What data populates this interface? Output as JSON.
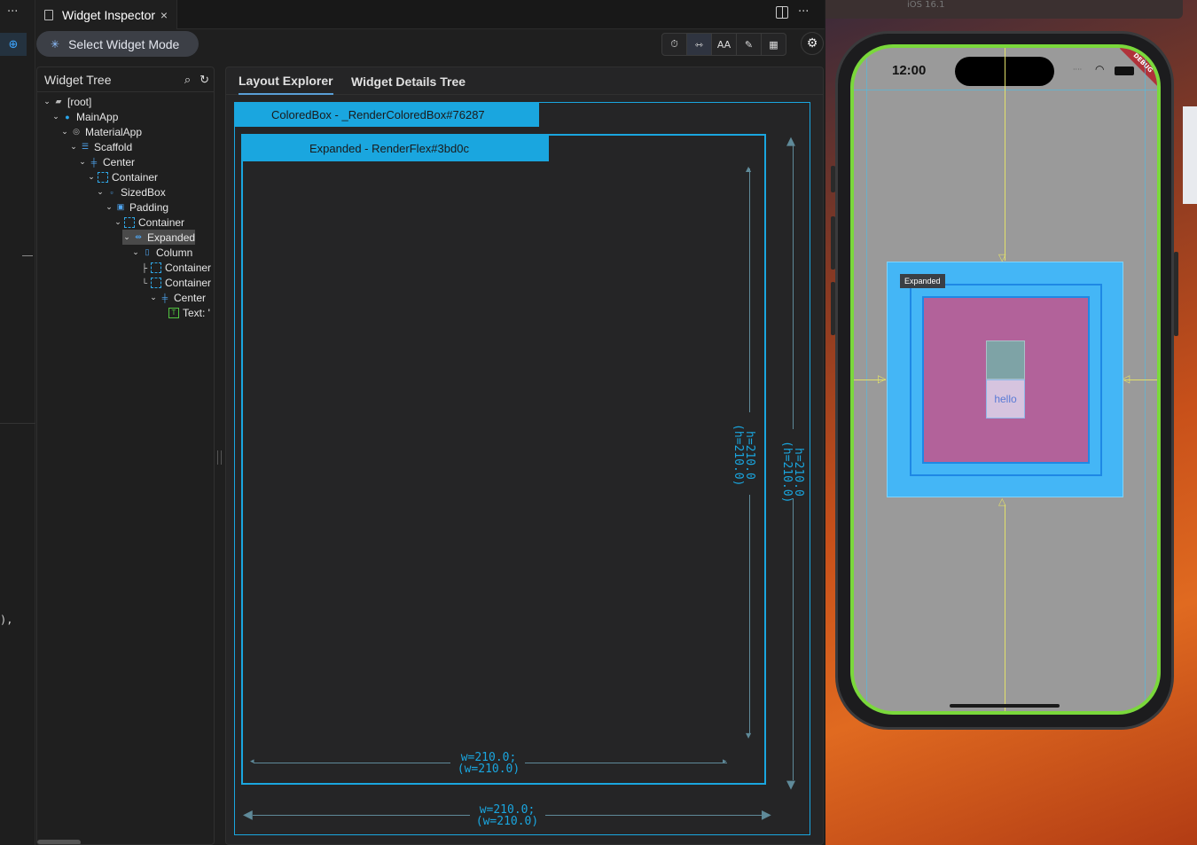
{
  "tab": {
    "title": "Widget Inspector",
    "close": "×"
  },
  "titlebar": {
    "menu": "···",
    "split": "▯",
    "more": "···"
  },
  "toolbar": {
    "select_mode": "Select Widget Mode",
    "tools": [
      "⏱",
      "⇿",
      "AA",
      "✎",
      "▦"
    ],
    "settings_icon": "⚙"
  },
  "tree": {
    "title": "Widget Tree",
    "nodes": [
      {
        "label": "[root]",
        "icon": "folder-icon"
      },
      {
        "label": "MainApp",
        "icon": "app-icon"
      },
      {
        "label": "MaterialApp",
        "icon": "material-icon"
      },
      {
        "label": "Scaffold",
        "icon": "scaffold-icon"
      },
      {
        "label": "Center",
        "icon": "center-icon"
      },
      {
        "label": "Container",
        "icon": "container-icon"
      },
      {
        "label": "SizedBox",
        "icon": "sizedbox-icon"
      },
      {
        "label": "Padding",
        "icon": "padding-icon"
      },
      {
        "label": "Container",
        "icon": "container-icon"
      },
      {
        "label": "Expanded",
        "icon": "expanded-icon"
      },
      {
        "label": "Column",
        "icon": "column-icon"
      },
      {
        "label": "Container",
        "icon": "container-icon"
      },
      {
        "label": "Container",
        "icon": "container-icon"
      },
      {
        "label": "Center",
        "icon": "center-icon"
      },
      {
        "label": "Text: '",
        "icon": "text-icon"
      }
    ],
    "selected": "Expanded"
  },
  "explorer": {
    "tabs": [
      "Layout Explorer",
      "Widget Details Tree"
    ],
    "outer_label": "ColoredBox - _RenderColoredBox#76287",
    "inner_label": "Expanded - RenderFlex#3bd0c",
    "inner_h": "h=210.0",
    "inner_h2": "(h=210.0)",
    "outer_h": "h=210.0",
    "outer_h2": "(h=210.0)",
    "inner_w": "w=210.0;",
    "inner_w2": "(w=210.0)",
    "outer_w": "w=210.0;",
    "outer_w2": "(w=210.0)"
  },
  "simulator": {
    "os": "iOS 16.1",
    "time": "12:00",
    "debug": "DEBUG",
    "tooltip": "Expanded",
    "hello": "hello"
  },
  "editor_snippet": "),",
  "colors": {
    "accent": "#1aa6df",
    "phone_border": "#7ad83b",
    "pink": "#b2629a",
    "blue": "#44b6f6"
  }
}
